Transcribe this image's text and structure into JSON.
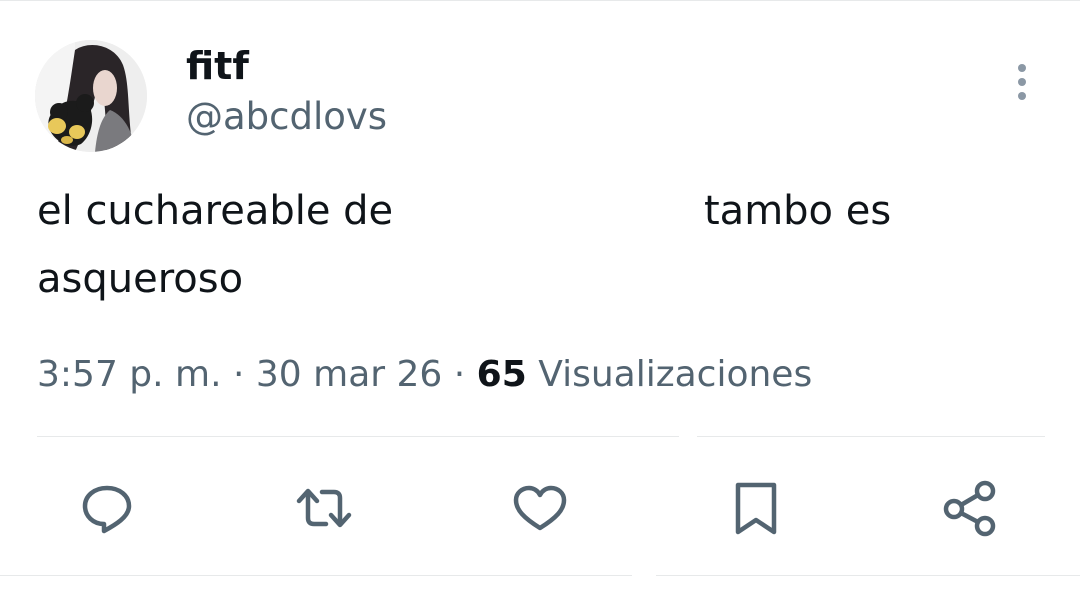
{
  "tweet": {
    "display_name": "fitf",
    "handle": "@abcdlovs",
    "text_line1_start": "el cuchareable de",
    "text_line1_end": "tambo es",
    "text_line2": "asqueroso",
    "time": "3:57 p. m.",
    "date": "30 mar 26",
    "views_count": "65",
    "views_label_start": "Visualiz",
    "views_label_end": "aciones"
  },
  "icons": {
    "more": "more-vertical-icon",
    "reply": "reply-icon",
    "retweet": "retweet-icon",
    "like": "heart-icon",
    "bookmark": "bookmark-icon",
    "share": "share-icon"
  },
  "colors": {
    "text_primary": "#0f1419",
    "text_secondary": "#536471",
    "divider": "#e7e9ea"
  }
}
